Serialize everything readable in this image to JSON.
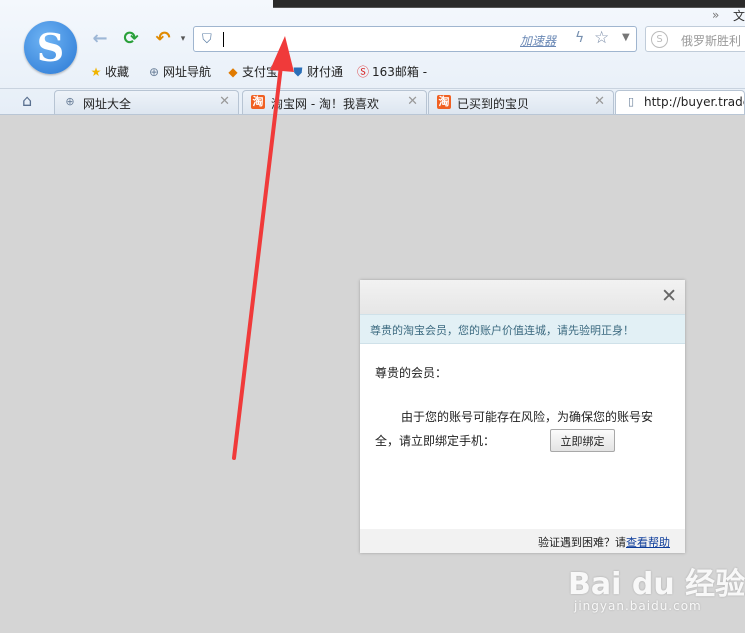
{
  "browser": {
    "logo_letter": "S",
    "address_value": "",
    "accelerator_label": "加速器",
    "search_placeholder": "俄罗斯胜利",
    "top_right_text": "文",
    "more_chevrons": "»"
  },
  "bookmarks": [
    {
      "label": "收藏",
      "icon": "star-icon"
    },
    {
      "label": "网址导航",
      "icon": "globe-icon"
    },
    {
      "label": "支付宝",
      "icon": "alipay-icon"
    },
    {
      "label": "财付通",
      "icon": "shield-icon"
    },
    {
      "label": "163邮箱 -",
      "icon": "netease-icon"
    }
  ],
  "tabs": [
    {
      "label": "网址大全",
      "icon": "globe-icon",
      "active": false
    },
    {
      "label": "淘宝网 - 淘！我喜欢",
      "icon": "taobao-icon",
      "active": false
    },
    {
      "label": "已买到的宝贝",
      "icon": "taobao-icon",
      "active": false
    },
    {
      "label": "http://buyer.trade",
      "icon": "page-icon",
      "active": true
    }
  ],
  "dialog": {
    "notice": "尊贵的淘宝会员，您的账户价值连城，请先验明正身！",
    "greeting": "尊贵的会员：",
    "message": "由于您的账号可能存在风险，为确保您的账号安全，请立即绑定手机：",
    "bind_button": "立即绑定",
    "footer_text": "验证遇到困难？请",
    "footer_link": "查看帮助"
  },
  "watermark": {
    "logo": "Bai du 经验",
    "url": "jingyan.baidu.com"
  },
  "colors": {
    "page_bg": "#d5d5d5",
    "arrow": "#f03a3a",
    "notice_bg": "#e2f0f5",
    "taobao_orange": "#f06022"
  }
}
